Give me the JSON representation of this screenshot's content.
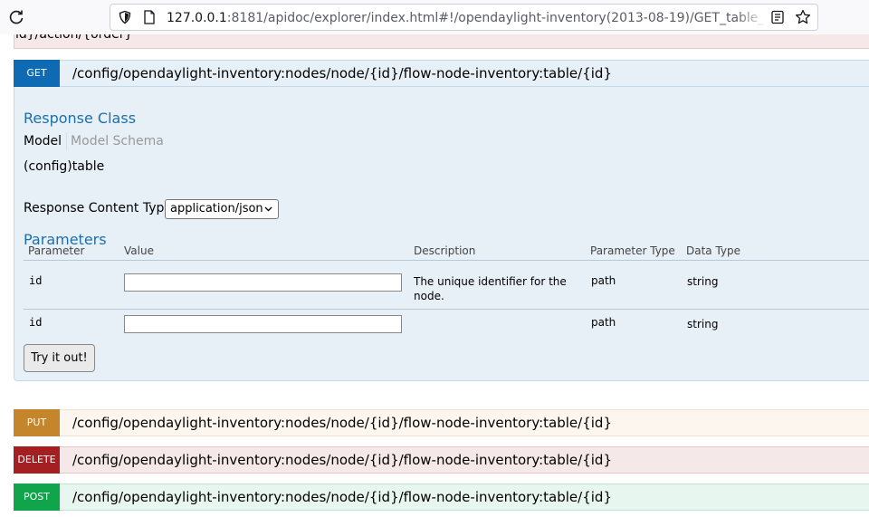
{
  "browser": {
    "url_host": "127.0.0.1",
    "url_rest": ":8181/apidoc/explorer/index.html#!/opendaylight-inventory(2013-08-19)/GET_table_config"
  },
  "previous_op": {
    "path_tail": "id}/action/{order}"
  },
  "get_op": {
    "method": "GET",
    "path": "/config/opendaylight-inventory:nodes/node/{id}/flow-node-inventory:table/{id}",
    "response_class_heading": "Response Class",
    "tabs": {
      "model": "Model",
      "schema": "Model Schema"
    },
    "model_name": "(config)table",
    "response_content_type_label": "Response Content Type",
    "response_content_type_value": "application/json",
    "parameters_heading": "Parameters",
    "columns": [
      "Parameter",
      "Value",
      "Description",
      "Parameter Type",
      "Data Type"
    ],
    "params": [
      {
        "name": "id",
        "value": "",
        "description": "The unique identifier for the node.",
        "param_type": "path",
        "data_type": "string"
      },
      {
        "name": "id",
        "value": "",
        "description": "",
        "param_type": "path",
        "data_type": "string"
      }
    ],
    "try_button": "Try it out!"
  },
  "other_ops": [
    {
      "method": "PUT",
      "path": "/config/opendaylight-inventory:nodes/node/{id}/flow-node-inventory:table/{id}"
    },
    {
      "method": "DELETE",
      "path": "/config/opendaylight-inventory:nodes/node/{id}/flow-node-inventory:table/{id}"
    },
    {
      "method": "POST",
      "path": "/config/opendaylight-inventory:nodes/node/{id}/flow-node-inventory:table/{id}"
    }
  ],
  "colors": {
    "get": "#0f6ab4",
    "put": "#c5862b",
    "delete": "#a41e22",
    "post": "#10a54a",
    "heading": "#1e6fa8"
  },
  "icons": [
    "reload-icon",
    "shield-icon",
    "page-icon",
    "reader-view-icon",
    "bookmark-star-icon",
    "chevron-down-icon"
  ]
}
